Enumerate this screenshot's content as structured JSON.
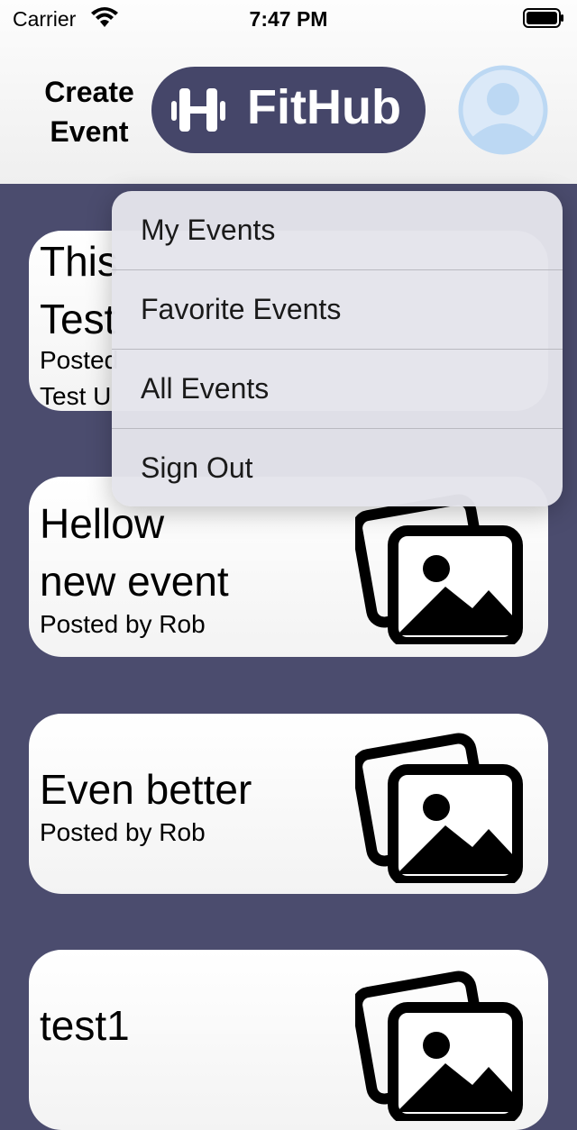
{
  "status_bar": {
    "carrier": "Carrier",
    "time": "7:47 PM"
  },
  "header": {
    "create_event_line1": "Create",
    "create_event_line2": "Event",
    "brand": "FitHub",
    "profile_icon": "person-circle-icon"
  },
  "menu": {
    "items": [
      {
        "label": "My Events"
      },
      {
        "label": "Favorite Events"
      },
      {
        "label": "All Events"
      },
      {
        "label": "Sign Out"
      }
    ]
  },
  "events": [
    {
      "title_line1": "This",
      "title_line2": "Test",
      "sub_line1": "Posted",
      "sub_line2": "Test U"
    },
    {
      "title_line1": "Hellow",
      "title_line2": "new event",
      "posted": "Posted by Rob",
      "icon": "photos-icon"
    },
    {
      "title": "Even better",
      "posted": "Posted by Rob",
      "icon": "photos-icon"
    },
    {
      "title": "test1",
      "icon": "photos-icon"
    }
  ],
  "colors": {
    "background": "#4b4c6e",
    "brand_pill": "#454669",
    "profile_accent": "#bcd8f3"
  }
}
